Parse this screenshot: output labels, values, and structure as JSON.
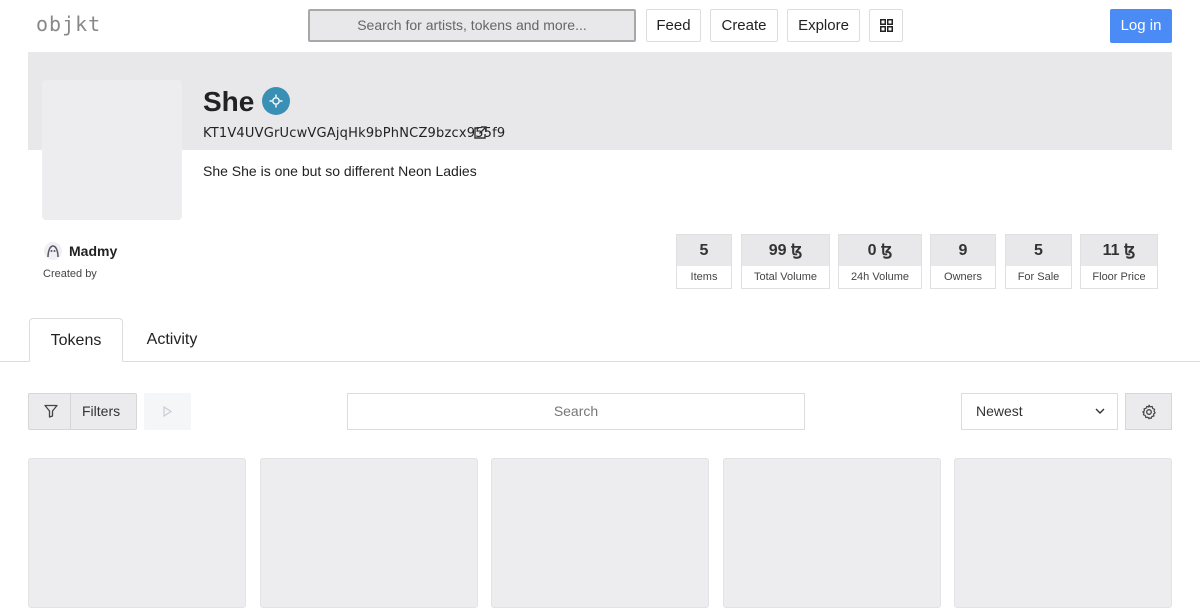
{
  "nav": {
    "logo": "objkt",
    "search_placeholder": "Search for artists, tokens and more...",
    "feed": "Feed",
    "create": "Create",
    "explore": "Explore",
    "login": "Log in"
  },
  "collection": {
    "title": "She",
    "address": "KT1V4UVGrUcwVGAjqHk9bPhNCZ9bzcx955f9",
    "description": "She She is one but so different Neon Ladies",
    "creator_name": "Madmy",
    "created_by_label": "Created by"
  },
  "stats": [
    {
      "value": "5",
      "unit": "",
      "label": "Items"
    },
    {
      "value": "99",
      "unit": "ꜩ",
      "label": "Total Volume"
    },
    {
      "value": "0",
      "unit": "ꜩ",
      "label": "24h Volume"
    },
    {
      "value": "9",
      "unit": "",
      "label": "Owners"
    },
    {
      "value": "5",
      "unit": "",
      "label": "For Sale"
    },
    {
      "value": "11",
      "unit": "ꜩ",
      "label": "Floor Price"
    }
  ],
  "tabs": [
    "Tokens",
    "Activity"
  ],
  "toolbar": {
    "filters": "Filters",
    "search_placeholder": "Search",
    "sort_selected": "Newest"
  },
  "colors": {
    "accent": "#4a8bf5",
    "verified": "#3a8fb5",
    "banner": "#e8e8ea"
  }
}
